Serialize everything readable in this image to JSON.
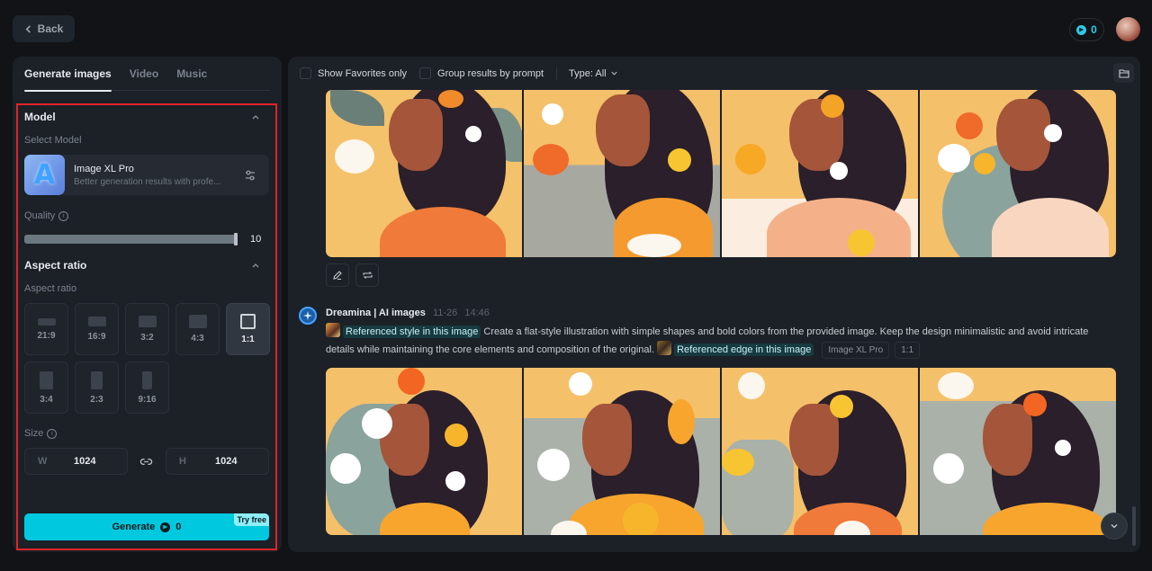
{
  "header": {
    "back_label": "Back",
    "credits": "0"
  },
  "left_panel": {
    "tabs": [
      {
        "label": "Generate images",
        "active": true
      },
      {
        "label": "Video",
        "active": false
      },
      {
        "label": "Music",
        "active": false
      }
    ],
    "model_section": {
      "title": "Model",
      "select_label": "Select Model",
      "model_name": "Image XL Pro",
      "model_desc": "Better generation results with profe...",
      "quality_label": "Quality",
      "quality_value": "10",
      "quality_fraction": 1.0
    },
    "aspect_section": {
      "title": "Aspect ratio",
      "sub_label": "Aspect ratio",
      "options": [
        {
          "label": "21:9",
          "selected": false
        },
        {
          "label": "16:9",
          "selected": false
        },
        {
          "label": "3:2",
          "selected": false
        },
        {
          "label": "4:3",
          "selected": false
        },
        {
          "label": "1:1",
          "selected": true
        },
        {
          "label": "3:4",
          "selected": false
        },
        {
          "label": "2:3",
          "selected": false
        },
        {
          "label": "9:16",
          "selected": false
        }
      ]
    },
    "size_section": {
      "label": "Size",
      "width_prefix": "W",
      "width_value": "1024",
      "height_prefix": "H",
      "height_value": "1024"
    },
    "generate": {
      "label": "Generate",
      "cost": "0",
      "badge": "Try free"
    }
  },
  "right_panel": {
    "filters": {
      "favorites_label": "Show Favorites only",
      "group_label": "Group results by prompt",
      "type_label": "Type: All"
    },
    "message": {
      "author": "Dreamina | AI images",
      "date": "11-26",
      "time": "14:46",
      "ref_style": "Referenced style in this image",
      "prompt": "Create a flat-style illustration with simple shapes and bold colors from the provided image. Keep the design minimalistic and avoid intricate details while maintaining the core elements and composition of the original.",
      "ref_edge": "Referenced edge in this image",
      "model_tag": "Image XL Pro",
      "ratio_tag": "1:1"
    }
  },
  "colors": {
    "accent": "#00c8de",
    "highlight_border": "#e0242a",
    "background": "#111316",
    "panel": "#1c2027"
  }
}
